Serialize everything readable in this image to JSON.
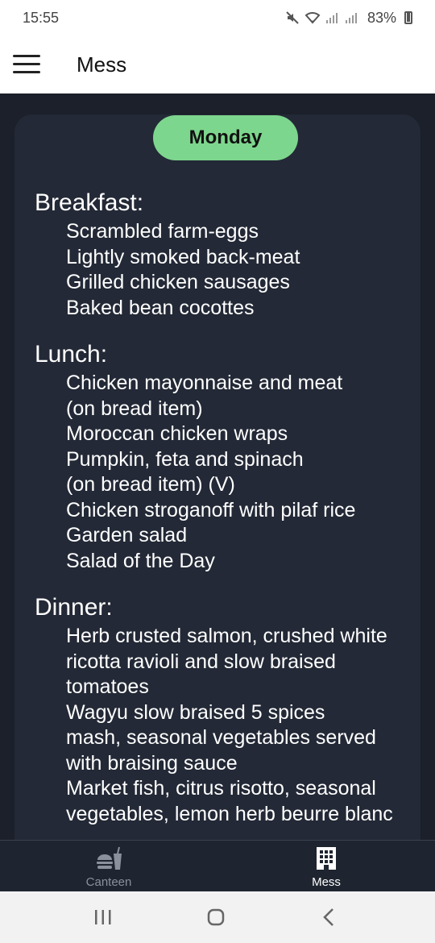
{
  "status_bar": {
    "time": "15:55",
    "battery": "83%"
  },
  "app_bar": {
    "title": "Mess"
  },
  "day": "Monday",
  "meals": [
    {
      "title": "Breakfast:",
      "items": [
        "Scrambled farm-eggs",
        "Lightly smoked back-meat",
        "Grilled chicken sausages",
        "Baked bean cocottes"
      ]
    },
    {
      "title": "Lunch:",
      "items": [
        "Chicken mayonnaise and meat",
        "(on bread item)",
        "Moroccan chicken wraps",
        "Pumpkin, feta and spinach",
        "(on bread item) (V)",
        "Chicken stroganoff with pilaf rice",
        "Garden salad",
        "Salad of the Day"
      ]
    },
    {
      "title": "Dinner:",
      "items": [
        "Herb crusted salmon, crushed white",
        "ricotta ravioli and slow braised",
        "tomatoes",
        "Wagyu slow braised 5 spices",
        "mash, seasonal vegetables served",
        "with braising sauce",
        "Market fish, citrus risotto, seasonal",
        "vegetables, lemon herb beurre blanc"
      ]
    }
  ],
  "bottom_nav": {
    "canteen": "Canteen",
    "mess": "Mess"
  },
  "colors": {
    "accent": "#7dd68d",
    "background": "#1b202a",
    "card": "#232936"
  }
}
